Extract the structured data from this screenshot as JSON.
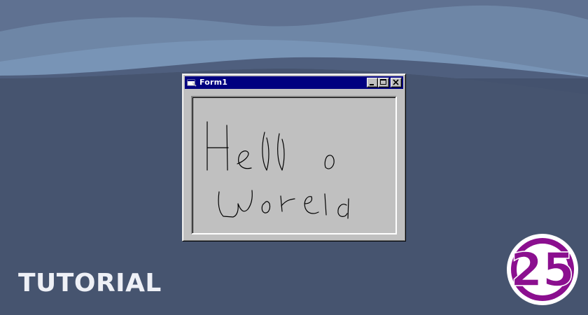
{
  "window": {
    "title": "Form1",
    "title_bar_color": "#000080",
    "face_color": "#c0c0c0",
    "buttons": [
      "minimize-icon",
      "maximize-icon",
      "close-icon"
    ]
  },
  "drawing": {
    "line1": "Hello",
    "line2": "World",
    "stroke_color": "#000000"
  },
  "caption": "TUTORIAL",
  "logo": {
    "text": "25",
    "color": "#8b0f8f"
  }
}
